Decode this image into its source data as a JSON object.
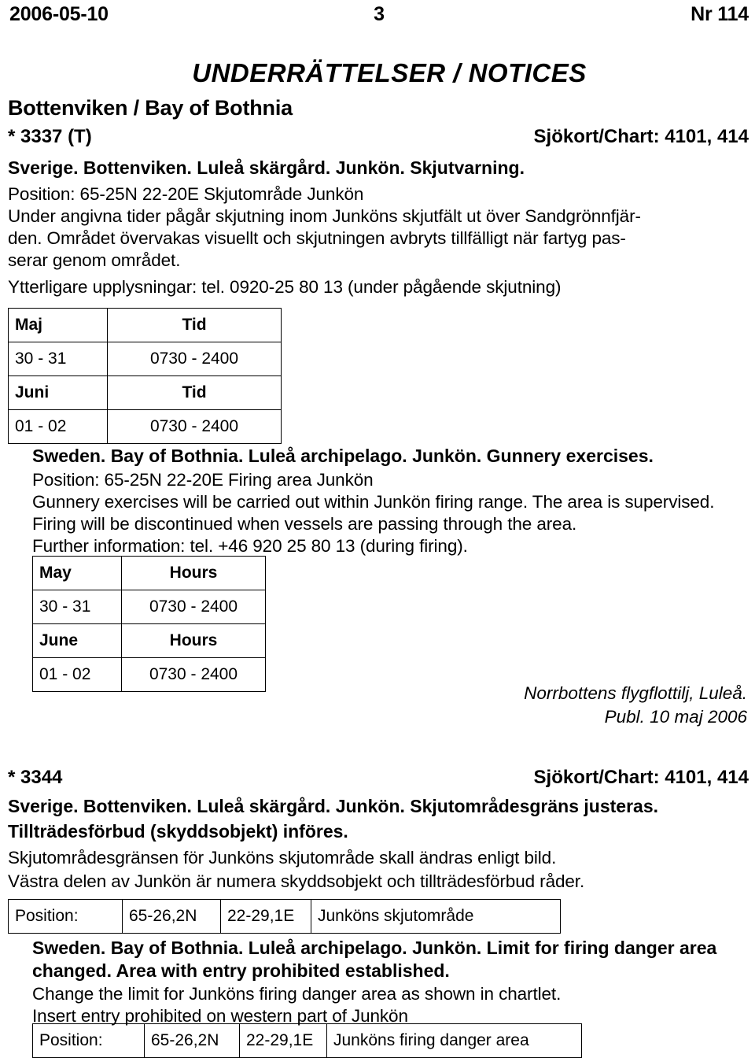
{
  "running_head": {
    "date": "2006-05-10",
    "page_number": "3",
    "issue": "Nr 114"
  },
  "document_title": "UNDERRÄTTELSER / NOTICES",
  "region_heading": "Bottenviken / Bay of Bothnia",
  "notices": [
    {
      "number": "* 3337 (T)",
      "chart_ref": "Sjökort/Chart: 4101, 414",
      "swedish": {
        "heading": "Sverige. Bottenviken. Luleå skärgård. Junkön. Skjutvarning.",
        "lines": [
          "Position: 65-25N 22-20E  Skjutområde Junkön",
          "Under angivna tider pågår skjutning inom Junköns skjutfält ut över Sandgrönnfjär-",
          "den. Området övervakas visuellt och skjutningen avbryts tillfälligt när fartyg pas-",
          "serar genom området.",
          "Ytterligare upplysningar: tel. 0920-25 80 13 (under pågående skjutning)"
        ],
        "table": {
          "rows": [
            {
              "cells": [
                "Maj",
                "Tid"
              ],
              "header": true
            },
            {
              "cells": [
                "30 - 31",
                "0730 - 2400"
              ],
              "header": false
            },
            {
              "cells": [
                "Juni",
                "Tid"
              ],
              "header": true
            },
            {
              "cells": [
                "01 - 02",
                "0730 - 2400"
              ],
              "header": false
            }
          ]
        }
      },
      "english": {
        "heading": "Sweden. Bay of Bothnia. Luleå archipelago. Junkön. Gunnery exercises.",
        "lines": [
          "Position: 65-25N  22-20E Firing area Junkön",
          "Gunnery exercises will be carried out within Junkön firing range. The area is supervised.",
          "Firing will be discontinued when vessels are passing through the area.",
          "Further information:  tel. +46 920 25 80 13 (during firing)."
        ],
        "table": {
          "rows": [
            {
              "cells": [
                "May",
                "Hours"
              ],
              "header": true
            },
            {
              "cells": [
                "30 - 31",
                "0730 - 2400"
              ],
              "header": false
            },
            {
              "cells": [
                "June",
                "Hours"
              ],
              "header": true
            },
            {
              "cells": [
                "01 - 02",
                "0730 - 2400"
              ],
              "header": false
            }
          ]
        }
      },
      "signature": {
        "authority": "Norrbottens flygflottilj, Luleå.",
        "published": "Publ. 10 maj 2006"
      }
    },
    {
      "number": "* 3344",
      "chart_ref": "Sjökort/Chart: 4101, 414",
      "swedish": {
        "heading_line1": "Sverige. Bottenviken. Luleå skärgård. Junkön. Skjutområdesgräns justeras.",
        "heading_line2": "Tillträdesförbud (skyddsobjekt) införes.",
        "lines": [
          "Skjutområdesgränsen för Junköns skjutområde skall ändras enligt bild.",
          "Västra delen av Junkön är numera skyddsobjekt och tillträdesförbud råder."
        ],
        "position_row": [
          "Position:",
          "65-26,2N",
          "22-29,1E",
          "Junköns skjutområde"
        ]
      },
      "english": {
        "heading_line1": "Sweden. Bay of Bothnia. Luleå archipelago. Junkön. Limit for firing danger area",
        "heading_line2": "changed. Area with entry prohibited established.",
        "lines": [
          "Change the limit for Junköns firing danger area as shown in chartlet.",
          "Insert entry prohibited on western part of Junkön"
        ],
        "position_row": [
          "Position:",
          "65-26,2N",
          "22-29,1E",
          "Junköns firing danger area"
        ]
      }
    }
  ]
}
